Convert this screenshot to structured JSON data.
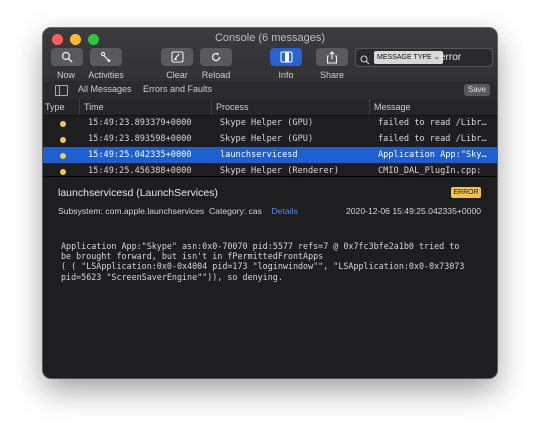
{
  "window": {
    "title": "Console (6 messages)"
  },
  "toolbar": {
    "now": {
      "label": "Now",
      "icon": "crosshair-icon"
    },
    "activities": {
      "label": "Activities",
      "icon": "activities-icon"
    },
    "clear": {
      "label": "Clear",
      "icon": "clear-icon"
    },
    "reload": {
      "label": "Reload",
      "icon": "reload-icon"
    },
    "info": {
      "label": "Info",
      "icon": "info-icon"
    },
    "share": {
      "label": "Share",
      "icon": "share-icon"
    }
  },
  "search": {
    "token": "MESSAGE TYPE",
    "value": "error"
  },
  "filters": {
    "all": "All Messages",
    "errors": "Errors and Faults",
    "save": "Save"
  },
  "table": {
    "headers": {
      "type": "Type",
      "time": "Time",
      "process": "Process",
      "message": "Message"
    },
    "rows": [
      {
        "time": "15:49:23.893379+0000",
        "process": "Skype Helper (GPU)",
        "message": "failed to read /Libr…"
      },
      {
        "time": "15:49:23.893598+0000",
        "process": "Skype Helper (GPU)",
        "message": "failed to read /Libr…"
      },
      {
        "time": "15:49:25.042335+0000",
        "process": "launchservicesd",
        "message": "Application App:\"Sky…"
      },
      {
        "time": "15:49:25.456388+0000",
        "process": "Skype Helper (Renderer)",
        "message": "CMIO_DAL_PlugIn.cpp:"
      }
    ]
  },
  "detail": {
    "title": "launchservicesd (LaunchServices)",
    "badge": "ERROR",
    "subsystem": "Subsystem: com.apple.launchservices",
    "category": "Category: cas",
    "details_link": "Details",
    "date": "2020-12-06 15:49:25.042335+0000",
    "message_lines": [
      "Application App:\"Skype\" asn:0x0-70070 pid:5577 refs=7 @ 0x7fc3bfe2a1b0 tried to",
      "be brought forward, but isn't in fPermittedFrontApps",
      "( ( \"LSApplication:0x0-0x4004 pid=173 \"loginwindow\"\", \"LSApplication:0x0-0x73073",
      "pid=5623 \"ScreenSaverEngine\"\")), so denying."
    ]
  },
  "colors": {
    "accent": "#1d5fd0",
    "error_dot": "#f2c94c",
    "link": "#4e8cf5",
    "badge": "#f0c44c"
  }
}
